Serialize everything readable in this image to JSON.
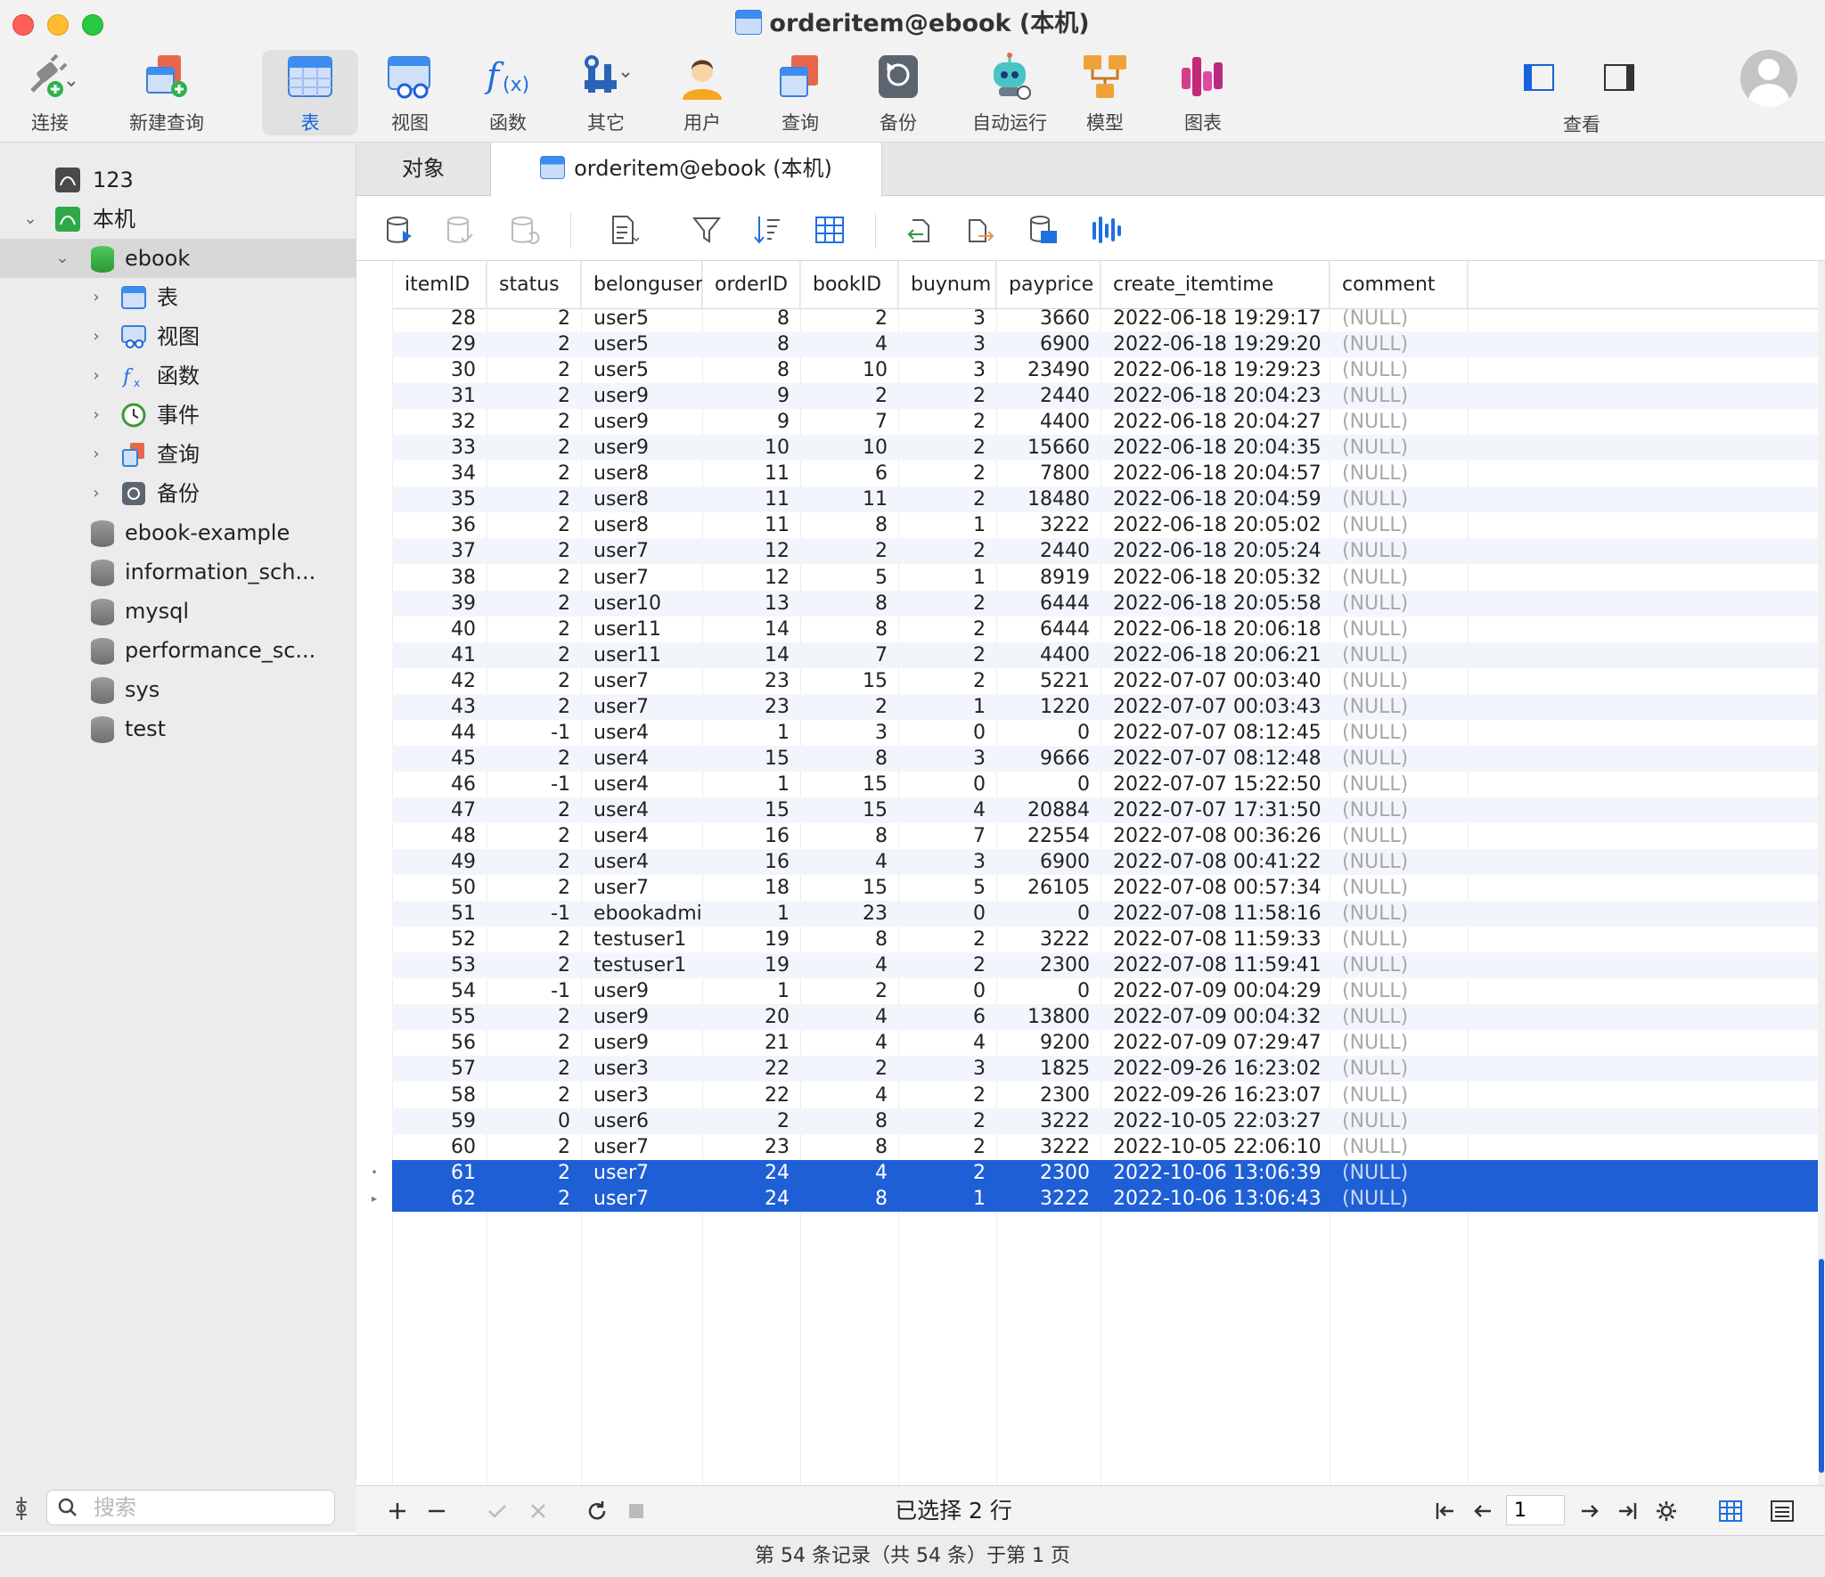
{
  "window": {
    "title": "orderitem@ebook (本机)"
  },
  "toolbar": [
    {
      "label": "连接",
      "icon": "plug-icon"
    },
    {
      "label": "新建查询",
      "icon": "new-query-icon"
    },
    {
      "label": "表",
      "icon": "table-icon",
      "active": true
    },
    {
      "label": "视图",
      "icon": "view-icon"
    },
    {
      "label": "函数",
      "icon": "function-icon"
    },
    {
      "label": "其它",
      "icon": "tools-icon"
    },
    {
      "label": "用户",
      "icon": "user-icon"
    },
    {
      "label": "查询",
      "icon": "query-icon"
    },
    {
      "label": "备份",
      "icon": "backup-icon"
    },
    {
      "label": "自动运行",
      "icon": "robot-icon"
    },
    {
      "label": "模型",
      "icon": "model-icon"
    },
    {
      "label": "图表",
      "icon": "chart-icon"
    }
  ],
  "view_label": "查看",
  "sidebar": {
    "items": [
      {
        "label": "123"
      },
      {
        "label": "本机"
      },
      {
        "label": "ebook"
      },
      {
        "label": "表"
      },
      {
        "label": "视图"
      },
      {
        "label": "函数"
      },
      {
        "label": "事件"
      },
      {
        "label": "查询"
      },
      {
        "label": "备份"
      },
      {
        "label": "ebook-example"
      },
      {
        "label": "information_sch..."
      },
      {
        "label": "mysql"
      },
      {
        "label": "performance_sc..."
      },
      {
        "label": "sys"
      },
      {
        "label": "test"
      }
    ],
    "search_placeholder": "搜索"
  },
  "tabs": {
    "objects": "对象",
    "current": "orderitem@ebook (本机)"
  },
  "grid": {
    "columns": [
      "itemID",
      "status",
      "belonguser",
      "orderID",
      "bookID",
      "buynum",
      "payprice",
      "create_itemtime",
      "comment"
    ],
    "rows": [
      [
        "28",
        "2",
        "user5",
        "8",
        "2",
        "3",
        "3660",
        "2022-06-18 19:29:17",
        "(NULL)"
      ],
      [
        "29",
        "2",
        "user5",
        "8",
        "4",
        "3",
        "6900",
        "2022-06-18 19:29:20",
        "(NULL)"
      ],
      [
        "30",
        "2",
        "user5",
        "8",
        "10",
        "3",
        "23490",
        "2022-06-18 19:29:23",
        "(NULL)"
      ],
      [
        "31",
        "2",
        "user9",
        "9",
        "2",
        "2",
        "2440",
        "2022-06-18 20:04:23",
        "(NULL)"
      ],
      [
        "32",
        "2",
        "user9",
        "9",
        "7",
        "2",
        "4400",
        "2022-06-18 20:04:27",
        "(NULL)"
      ],
      [
        "33",
        "2",
        "user9",
        "10",
        "10",
        "2",
        "15660",
        "2022-06-18 20:04:35",
        "(NULL)"
      ],
      [
        "34",
        "2",
        "user8",
        "11",
        "6",
        "2",
        "7800",
        "2022-06-18 20:04:57",
        "(NULL)"
      ],
      [
        "35",
        "2",
        "user8",
        "11",
        "11",
        "2",
        "18480",
        "2022-06-18 20:04:59",
        "(NULL)"
      ],
      [
        "36",
        "2",
        "user8",
        "11",
        "8",
        "1",
        "3222",
        "2022-06-18 20:05:02",
        "(NULL)"
      ],
      [
        "37",
        "2",
        "user7",
        "12",
        "2",
        "2",
        "2440",
        "2022-06-18 20:05:24",
        "(NULL)"
      ],
      [
        "38",
        "2",
        "user7",
        "12",
        "5",
        "1",
        "8919",
        "2022-06-18 20:05:32",
        "(NULL)"
      ],
      [
        "39",
        "2",
        "user10",
        "13",
        "8",
        "2",
        "6444",
        "2022-06-18 20:05:58",
        "(NULL)"
      ],
      [
        "40",
        "2",
        "user11",
        "14",
        "8",
        "2",
        "6444",
        "2022-06-18 20:06:18",
        "(NULL)"
      ],
      [
        "41",
        "2",
        "user11",
        "14",
        "7",
        "2",
        "4400",
        "2022-06-18 20:06:21",
        "(NULL)"
      ],
      [
        "42",
        "2",
        "user7",
        "23",
        "15",
        "2",
        "5221",
        "2022-07-07 00:03:40",
        "(NULL)"
      ],
      [
        "43",
        "2",
        "user7",
        "23",
        "2",
        "1",
        "1220",
        "2022-07-07 00:03:43",
        "(NULL)"
      ],
      [
        "44",
        "-1",
        "user4",
        "1",
        "3",
        "0",
        "0",
        "2022-07-07 08:12:45",
        "(NULL)"
      ],
      [
        "45",
        "2",
        "user4",
        "15",
        "8",
        "3",
        "9666",
        "2022-07-07 08:12:48",
        "(NULL)"
      ],
      [
        "46",
        "-1",
        "user4",
        "1",
        "15",
        "0",
        "0",
        "2022-07-07 15:22:50",
        "(NULL)"
      ],
      [
        "47",
        "2",
        "user4",
        "15",
        "15",
        "4",
        "20884",
        "2022-07-07 17:31:50",
        "(NULL)"
      ],
      [
        "48",
        "2",
        "user4",
        "16",
        "8",
        "7",
        "22554",
        "2022-07-08 00:36:26",
        "(NULL)"
      ],
      [
        "49",
        "2",
        "user4",
        "16",
        "4",
        "3",
        "6900",
        "2022-07-08 00:41:22",
        "(NULL)"
      ],
      [
        "50",
        "2",
        "user7",
        "18",
        "15",
        "5",
        "26105",
        "2022-07-08 00:57:34",
        "(NULL)"
      ],
      [
        "51",
        "-1",
        "ebookadmin",
        "1",
        "23",
        "0",
        "0",
        "2022-07-08 11:58:16",
        "(NULL)"
      ],
      [
        "52",
        "2",
        "testuser1",
        "19",
        "8",
        "2",
        "3222",
        "2022-07-08 11:59:33",
        "(NULL)"
      ],
      [
        "53",
        "2",
        "testuser1",
        "19",
        "4",
        "2",
        "2300",
        "2022-07-08 11:59:41",
        "(NULL)"
      ],
      [
        "54",
        "-1",
        "user9",
        "1",
        "2",
        "0",
        "0",
        "2022-07-09 00:04:29",
        "(NULL)"
      ],
      [
        "55",
        "2",
        "user9",
        "20",
        "4",
        "6",
        "13800",
        "2022-07-09 00:04:32",
        "(NULL)"
      ],
      [
        "56",
        "2",
        "user9",
        "21",
        "4",
        "4",
        "9200",
        "2022-07-09 07:29:47",
        "(NULL)"
      ],
      [
        "57",
        "2",
        "user3",
        "22",
        "2",
        "3",
        "1825",
        "2022-09-26 16:23:02",
        "(NULL)"
      ],
      [
        "58",
        "2",
        "user3",
        "22",
        "4",
        "2",
        "2300",
        "2022-09-26 16:23:07",
        "(NULL)"
      ],
      [
        "59",
        "0",
        "user6",
        "2",
        "8",
        "2",
        "3222",
        "2022-10-05 22:03:27",
        "(NULL)"
      ],
      [
        "60",
        "2",
        "user7",
        "23",
        "8",
        "2",
        "3222",
        "2022-10-05 22:06:10",
        "(NULL)"
      ],
      [
        "61",
        "2",
        "user7",
        "24",
        "4",
        "2",
        "2300",
        "2022-10-06 13:06:39",
        "(NULL)"
      ],
      [
        "62",
        "2",
        "user7",
        "24",
        "8",
        "1",
        "3222",
        "2022-10-06 13:06:43",
        "(NULL)"
      ]
    ],
    "selected_rows": [
      33,
      34
    ]
  },
  "bottom": {
    "selection": "已选择 2 行",
    "page": "1"
  },
  "status": "第 54 条记录（共 54 条）于第 1 页",
  "colors": {
    "accent": "#1463d8",
    "selection": "#1f5fd6",
    "alt_row": "#f2f6fc"
  }
}
